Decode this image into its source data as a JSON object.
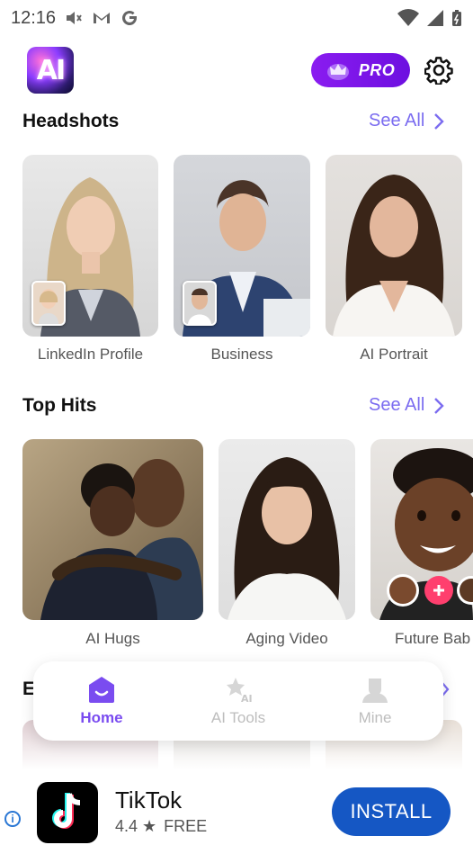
{
  "status_bar": {
    "time": "12:16",
    "left_icons": [
      "volume-icon",
      "gmail-icon",
      "google-icon"
    ],
    "right_icons": [
      "wifi-icon",
      "signal-icon",
      "battery-icon"
    ]
  },
  "header": {
    "logo_text": "AI",
    "pro_label": "PRO",
    "settings_icon": "gear-icon"
  },
  "headshots": {
    "title": "Headshots",
    "see_all": "See All",
    "cards": [
      {
        "label": "LinkedIn Profile"
      },
      {
        "label": "Business"
      },
      {
        "label": "AI Portrait"
      }
    ]
  },
  "top_hits": {
    "title": "Top Hits",
    "see_all": "See All",
    "cards": [
      {
        "label": "AI Hugs"
      },
      {
        "label": "Aging Video"
      },
      {
        "label": "Future Bab"
      }
    ]
  },
  "next_section": {
    "title_partial": "E"
  },
  "bottom_nav": {
    "items": [
      {
        "label": "Home",
        "icon": "home-icon",
        "active": true
      },
      {
        "label": "AI Tools",
        "icon": "ai-tools-icon",
        "active": false
      },
      {
        "label": "Mine",
        "icon": "profile-icon",
        "active": false
      }
    ]
  },
  "ad": {
    "app_name": "TikTok",
    "rating": "4.4 ★",
    "price": "FREE",
    "install_label": "INSTALL",
    "colors": {
      "install": "#1557c4"
    }
  },
  "colors": {
    "accent": "#7b6cf0",
    "pro_gradient_start": "#8a1cf0",
    "nav_active": "#7a4cf0"
  }
}
